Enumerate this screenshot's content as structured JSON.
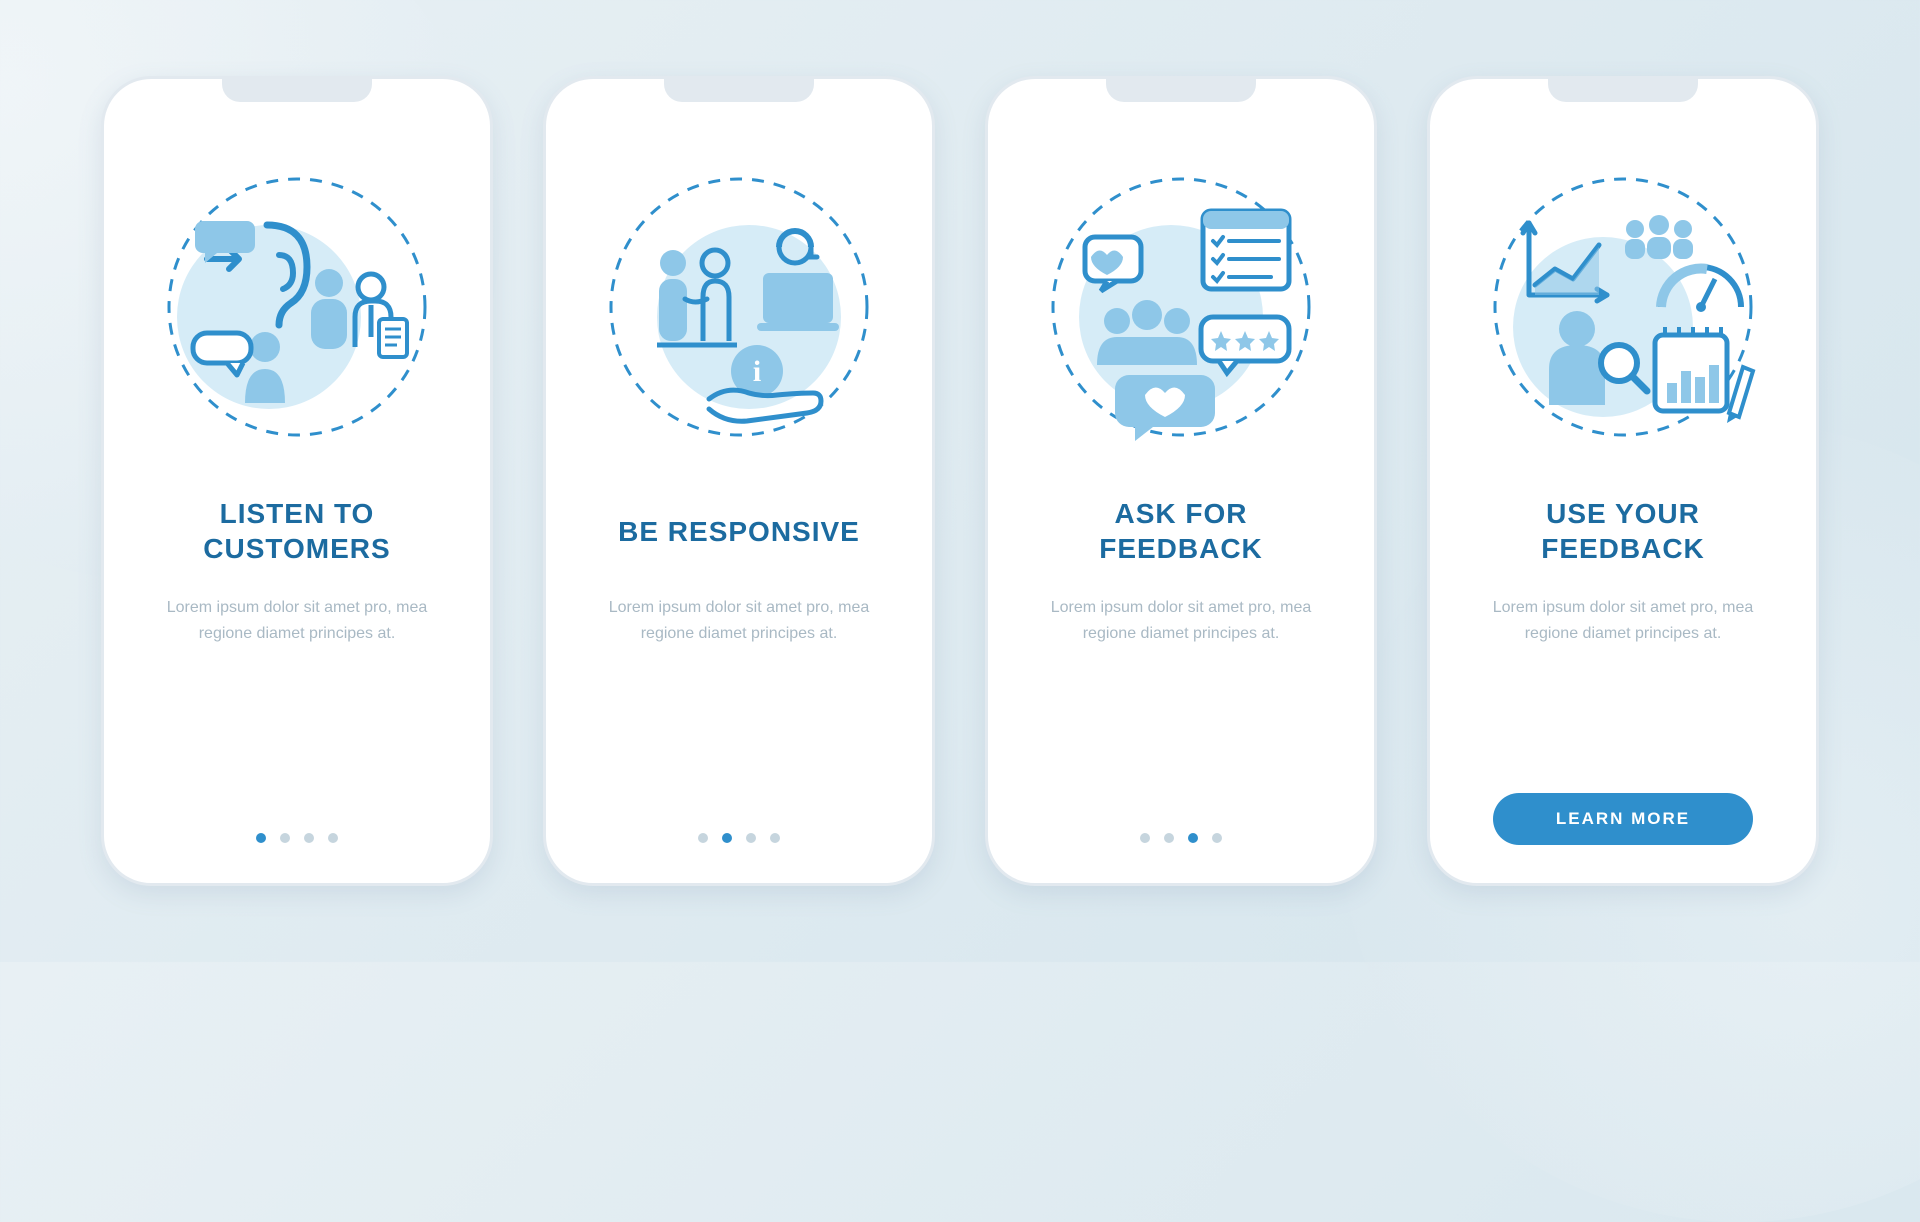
{
  "colors": {
    "accent": "#2f8fcc",
    "title": "#1c6ba0",
    "muted_text": "#a9b9c4",
    "dot_inactive": "#c6d5de",
    "frame": "#e2e9ef",
    "illus_fill": "#8ec7e8",
    "illus_light": "#d6ecf7"
  },
  "screens": [
    {
      "title": "LISTEN TO\nCUSTOMERS",
      "description": "Lorem ipsum dolor sit amet pro, mea regione diamet principes at.",
      "active_dot": 0,
      "icon_name": "listen-customers-illustration"
    },
    {
      "title": "BE RESPONSIVE",
      "description": "Lorem ipsum dolor sit amet pro, mea regione diamet principes at.",
      "active_dot": 1,
      "icon_name": "be-responsive-illustration"
    },
    {
      "title": "ASK FOR\nFEEDBACK",
      "description": "Lorem ipsum dolor sit amet pro, mea regione diamet principes at.",
      "active_dot": 2,
      "icon_name": "ask-feedback-illustration"
    },
    {
      "title": "USE YOUR\nFEEDBACK",
      "description": "Lorem ipsum dolor sit amet pro, mea regione diamet principes at.",
      "active_dot": 3,
      "icon_name": "use-feedback-illustration",
      "cta_label": "LEARN MORE"
    }
  ],
  "total_dots": 4
}
